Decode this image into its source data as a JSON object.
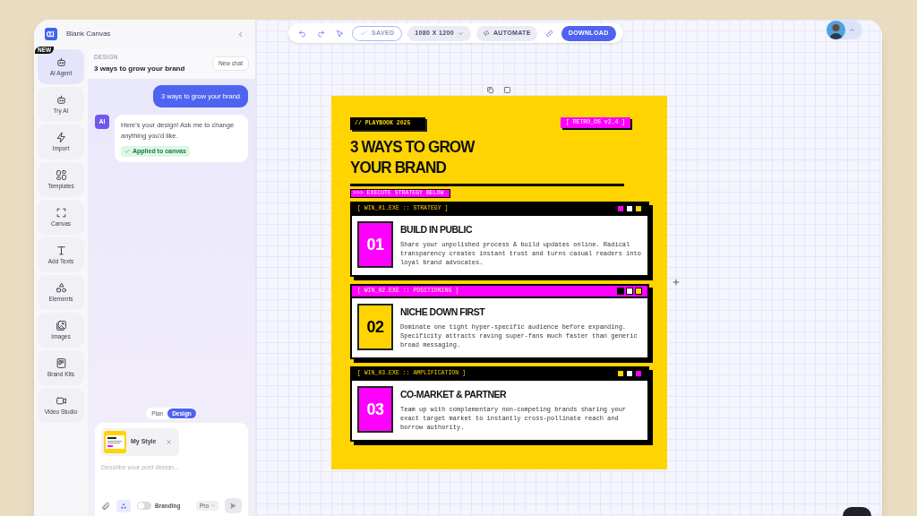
{
  "app": {
    "title": "Blank Canvas"
  },
  "rail": [
    {
      "label": "AI Agent",
      "selected": true,
      "badge": "NEW"
    },
    {
      "label": "Try AI",
      "selected": false
    },
    {
      "label": "Import",
      "selected": false
    },
    {
      "label": "Templates",
      "selected": false
    },
    {
      "label": "Canvas",
      "selected": false
    },
    {
      "label": "Add Texts",
      "selected": false
    },
    {
      "label": "Elements",
      "selected": false
    },
    {
      "label": "Images",
      "selected": false
    },
    {
      "label": "Brand Kits",
      "selected": false
    },
    {
      "label": "Video Studio",
      "selected": false
    }
  ],
  "chat": {
    "section": "DESIGN",
    "title": "3 ways to grow your brand",
    "new_chat": "New chat",
    "messages": [
      {
        "kind": "user",
        "text": "3 ways to grow your brand"
      },
      {
        "kind": "ai",
        "avatar": "AI",
        "text": "Here's your design! Ask me to change anything you'd like.",
        "status": "Applied to canvas"
      }
    ],
    "modes": [
      {
        "label": "Plan",
        "selected": false
      },
      {
        "label": "Design",
        "selected": true
      }
    ],
    "composer": {
      "style_chip": "My Style",
      "placeholder": "Describe your post design...",
      "branding": {
        "label": "Branding",
        "on": false
      },
      "model": "Pro"
    }
  },
  "toolbar": {
    "saved": "SAVED",
    "size": "1080 X 1200",
    "automate": "AUTOMATE",
    "download": "DOWNLOAD"
  },
  "poster": {
    "tag": "// PLAYBOOK 2025",
    "version": "[ RETRO_OS v2.4 ]",
    "title_lines": [
      "3 WAYS TO GROW",
      "YOUR BRAND"
    ],
    "banner": ">>> EXECUTE STRATEGY BELOW",
    "cards": [
      {
        "header": {
          "text": "[ WIN_01.EXE :: STRATEGY ]",
          "color": "#000000"
        },
        "number": {
          "text": "01",
          "color": "#ff00ff"
        },
        "squares": [
          {
            "color": "#ff00ff"
          },
          {
            "color": "#ffffff"
          },
          {
            "color": "#ffd400"
          }
        ],
        "title": "BUILD IN PUBLIC",
        "text": "Share your unpolished process & build updates online. Radical transparency creates instant trust and turns casual readers into loyal brand advocates."
      },
      {
        "header": {
          "text": "[ WIN_02.EXE :: POSITIONING ]",
          "color": "#ff00ff"
        },
        "number": {
          "text": "02",
          "color": "#ffd400"
        },
        "squares": [
          {
            "color": "#000000"
          },
          {
            "color": "#ffffff"
          },
          {
            "color": "#ffd400"
          }
        ],
        "title": "NICHE DOWN FIRST",
        "text": "Dominate one tight hyper-specific audience before expanding. Specificity attracts raving super-fans much faster than generic broad messaging."
      },
      {
        "header": {
          "text": "[ WIN_03.EXE :: AMPLIFICATION ]",
          "color": "#000000"
        },
        "number": {
          "text": "03",
          "color": "#ff00ff"
        },
        "squares": [
          {
            "color": "#ffd400"
          },
          {
            "color": "#ffffff"
          },
          {
            "color": "#ff00ff"
          }
        ],
        "title": "CO-MARKET & PARTNER",
        "text": "Team up with complementary non-competing brands sharing your exact target market to instantly cross-pollinate reach and borrow authority."
      }
    ]
  }
}
